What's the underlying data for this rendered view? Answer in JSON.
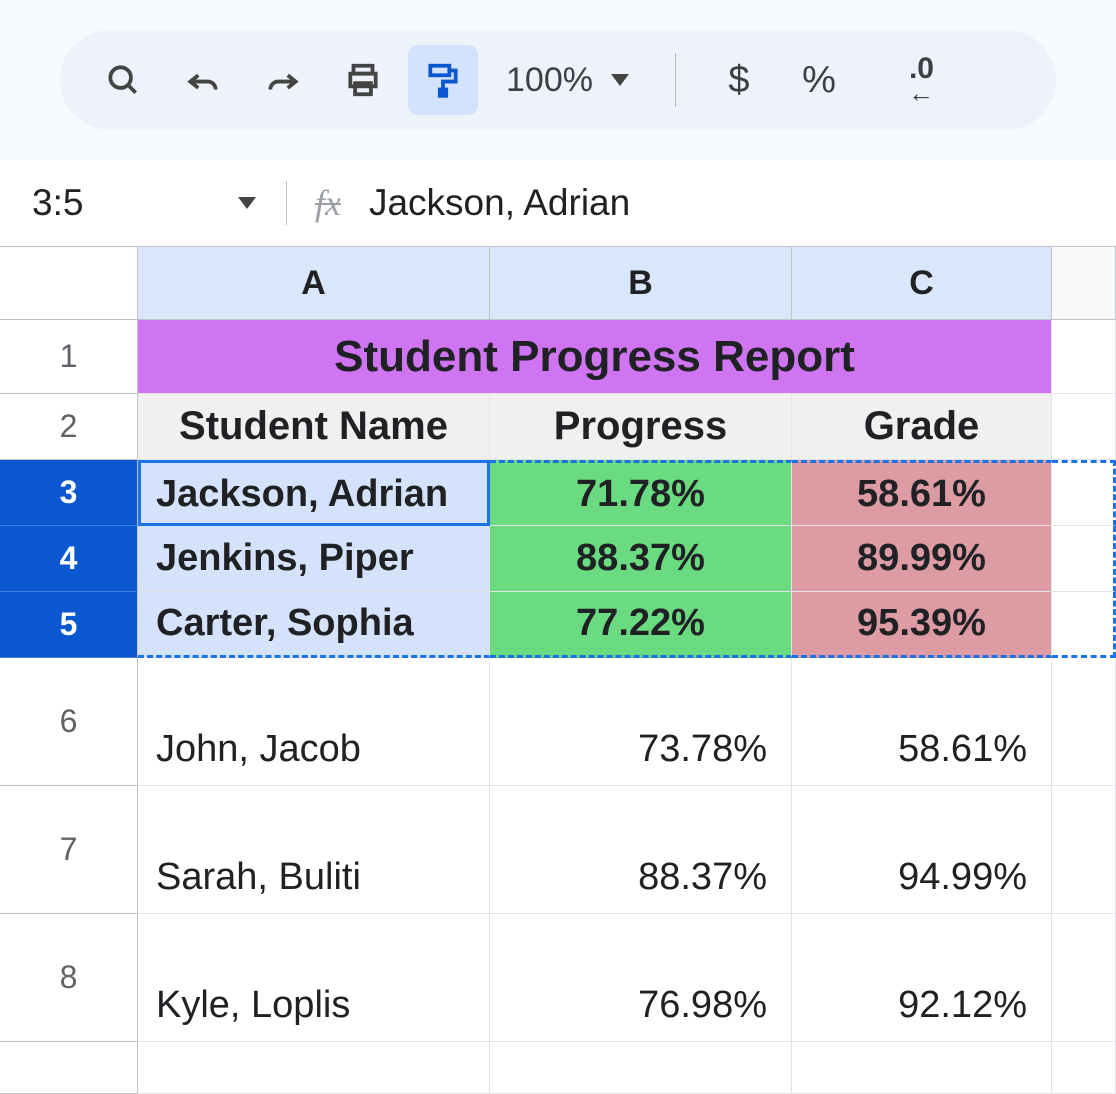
{
  "toolbar": {
    "zoom": "100%"
  },
  "namebox": "3:5",
  "formula": "Jackson, Adrian",
  "columns": [
    "A",
    "B",
    "C"
  ],
  "rows": [
    "1",
    "2",
    "3",
    "4",
    "5",
    "6",
    "7",
    "8"
  ],
  "title": "Student Progress Report",
  "headers": {
    "a": "Student Name",
    "b": "Progress",
    "c": "Grade"
  },
  "data": [
    {
      "name": "Jackson, Adrian",
      "progress": "71.78%",
      "grade": "58.61%"
    },
    {
      "name": "Jenkins, Piper",
      "progress": "88.37%",
      "grade": "89.99%"
    },
    {
      "name": "Carter, Sophia",
      "progress": "77.22%",
      "grade": "95.39%"
    },
    {
      "name": "John, Jacob",
      "progress": "73.78%",
      "grade": "58.61%"
    },
    {
      "name": "Sarah, Buliti",
      "progress": "88.37%",
      "grade": "94.99%"
    },
    {
      "name": "Kyle, Loplis",
      "progress": "76.98%",
      "grade": "92.12%"
    }
  ]
}
